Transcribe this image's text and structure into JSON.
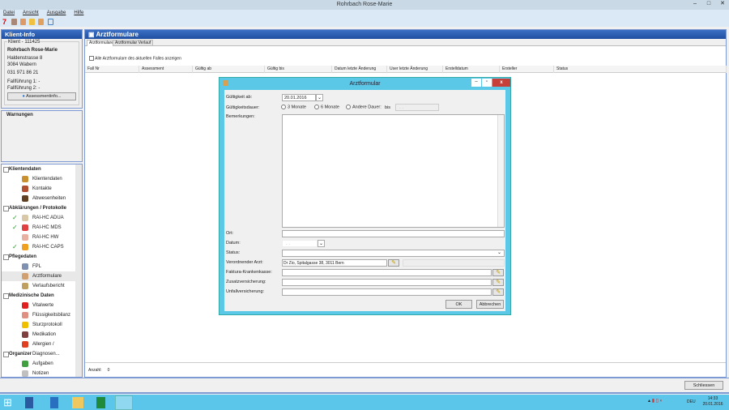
{
  "window": {
    "title": "Rohrbach Rose-Marie",
    "controls": [
      "minimize",
      "maximize",
      "close"
    ]
  },
  "menu": [
    "Datei",
    "Ansicht",
    "Ausgabe",
    "Hilfe"
  ],
  "klient_info": {
    "header": "Klient-Info",
    "group": "Klient - 111425",
    "name": "Rohrbach Rose-Marie",
    "street": "Haldenstrasse 8",
    "city": "3084 Wabern",
    "phone": "031 971 86 21",
    "fall1": "Fallführung 1: -",
    "fall2": "Fallführung 2: -",
    "assessment_btn": "Assessmentinfo..."
  },
  "warnungen": {
    "header": "Warnungen"
  },
  "tree": [
    {
      "group": "Klientendaten",
      "items": [
        {
          "label": "Klientendaten",
          "check": false,
          "color": "#c89030"
        },
        {
          "label": "Kontakte",
          "check": false,
          "color": "#b05030"
        },
        {
          "label": "Abwesenheiten",
          "check": false,
          "color": "#604020"
        }
      ]
    },
    {
      "group": "Abklärungen / Protokolle",
      "items": [
        {
          "label": "RAI-HC ADUA",
          "check": true,
          "color": "#d8c8a8"
        },
        {
          "label": "RAI-HC MDS",
          "check": true,
          "color": "#e04040"
        },
        {
          "label": "RAI-HC HW",
          "check": false,
          "color": "#e8b0a0"
        },
        {
          "label": "RAI-HC CAPS",
          "check": true,
          "color": "#f0a020"
        }
      ]
    },
    {
      "group": "Pflegedaten",
      "items": [
        {
          "label": "FPL",
          "check": false,
          "color": "#8090b0"
        },
        {
          "label": "Arztformulare",
          "check": false,
          "color": "#d0a070",
          "selected": true
        },
        {
          "label": "Verlaufsbericht",
          "check": false,
          "color": "#c0a060"
        }
      ]
    },
    {
      "group": "Medizinische Daten",
      "items": [
        {
          "label": "Vitalwerte",
          "check": false,
          "color": "#e02020"
        },
        {
          "label": "Flüssigkeitsbilanz",
          "check": false,
          "color": "#e09080"
        },
        {
          "label": "Sturzprotokoll",
          "check": false,
          "color": "#f0c000"
        },
        {
          "label": "Medikation",
          "check": false,
          "color": "#804040"
        },
        {
          "label": "Allergien / Diagnosen...",
          "check": false,
          "color": "#e04020"
        }
      ]
    },
    {
      "group": "Organizer",
      "items": [
        {
          "label": "Aufgaben",
          "check": false,
          "color": "#40a040"
        },
        {
          "label": "Notizen",
          "check": false,
          "color": "#c0c0c0"
        }
      ]
    }
  ],
  "main": {
    "header": "Arztformulare",
    "tabs": [
      "Arztformulare",
      "Arztformular Verlauf"
    ],
    "active_tab": 0,
    "checkbox_label": "Alle Arztformulare des aktuellen Falles anzeigen",
    "checkbox_checked": false,
    "columns": [
      "Fall Nr",
      "Assessment",
      "Gültig ab",
      "Gültig bis",
      "Datum letzte Änderung",
      "User letzte Änderung",
      "Erstelldatum",
      "Ersteller",
      "Status"
    ],
    "rows": [],
    "count_label": "Anzahl:",
    "count": "0",
    "close_btn": "Schliessen"
  },
  "dialog": {
    "title": "Arztformular",
    "gueltig_ab_label": "Gültigkeit ab:",
    "gueltig_ab": "20.01.2016",
    "dauer_label": "Gültigkeitsdauer:",
    "options": [
      "3 Monate",
      "6 Monate",
      "Andere Dauer:"
    ],
    "bis_label": "bis",
    "bis_value": "  .  .",
    "bemerkungen_label": "Bemerkungen:",
    "bemerkungen": "",
    "ort_label": "Ort:",
    "ort": "",
    "datum_label": "Datum:",
    "datum": "  .  .",
    "status_label": "Status:",
    "status": "",
    "arzt_label": "Verordnender Arzt:",
    "arzt": "Dr Zio, Spitalgasse 38, 3011 Bern",
    "faktura_label": "Faktura-Krankenkasse:",
    "faktura": "",
    "zusatz_label": "Zusatzversicherung:",
    "zusatz": "",
    "unfall_label": "Unfallversicherung:",
    "unfall": "",
    "ok": "OK",
    "cancel": "Abbrechen"
  },
  "tray": {
    "lang": "DEU",
    "time": "14:33",
    "date": "20.01.2016"
  },
  "colors": {
    "accent": "#1e4ea0",
    "dialog_title": "#5bc8e8",
    "taskbar": "#5cc6ea",
    "close": "#c8403a"
  }
}
